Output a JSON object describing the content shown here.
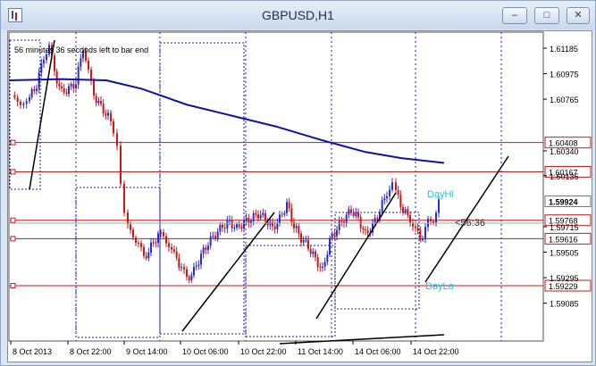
{
  "window": {
    "title": "GBPUSD,H1",
    "controls": {
      "minimize": "–",
      "maximize": "□",
      "close": "✕"
    }
  },
  "info_text": "56 minutes 36 seconds left to bar end",
  "labels": {
    "day_hi": "DayHi",
    "day_lo": "DayLo",
    "countdown": "<56:36"
  },
  "colors": {
    "bull": "#2b2bd0",
    "bear": "#d01515",
    "ma": "#1010b0",
    "level_line": "#d01515",
    "label_cyan": "#19c7e6"
  },
  "chart_data": {
    "type": "candlestick",
    "symbol": "GBPUSD",
    "timeframe": "H1",
    "price_ticks": [
      "1.61185",
      "1.60975",
      "1.60765",
      "1.60340",
      "1.60135",
      "1.59715",
      "1.59505",
      "1.59295",
      "1.59085"
    ],
    "x_ticks": [
      "8 Oct 2013",
      "8 Oct 22:00",
      "9 Oct 14:00",
      "10 Oct 06:00",
      "10 Oct 22:00",
      "11 Oct 14:00",
      "14 Oct 06:00",
      "14 Oct 22:00"
    ],
    "horizontal_levels": [
      "1.60408",
      "1.60167",
      "1.59924",
      "1.59768",
      "1.59616",
      "1.59229"
    ],
    "current_price": "1.59924",
    "countdown": "<56:36",
    "moving_average": true
  }
}
